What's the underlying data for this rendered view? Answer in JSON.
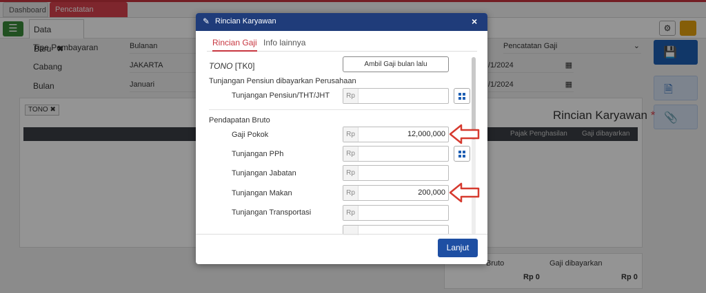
{
  "app_tabs": [
    {
      "label": "Dashboard"
    },
    {
      "label": "Pencatatan Gaji",
      "close": "✖"
    }
  ],
  "doc_tab": {
    "label": "Data Baru",
    "close": "✖"
  },
  "form": {
    "tipe_label": "Tipe Pembayaran",
    "tipe_value": "Bulanan",
    "cabang_label": "Cabang",
    "cabang_value": "JAKARTA",
    "bulan_label": "Bulan",
    "bulan_value": "Januari",
    "transaksi_value": "Pencatatan Gaji",
    "date1": "/1/2024",
    "date2": "/1/2024"
  },
  "card": {
    "tag": "TONO",
    "title": "Rincian Karyawan",
    "required_mark": "*",
    "col_pajak": "Pajak Penghasilan",
    "col_gaji": "Gaji dibayarkan"
  },
  "summary": {
    "bruto_label": "Bruto",
    "bruto_value": "Rp 0",
    "gaji_label": "Gaji dibayarkan",
    "gaji_value": "Rp 0"
  },
  "modal": {
    "title": "Rincian Karyawan",
    "close": "×",
    "tabs": [
      {
        "label": "Rincian Gaji",
        "active": true
      },
      {
        "label": "Info lainnya",
        "active": false
      }
    ],
    "employee_name": "TONO",
    "employee_code": "[TK0]",
    "prev_month_button": "Ambil Gaji bulan lalu",
    "section_pensiun": "Tunjangan Pensiun dibayarkan Perusahaan",
    "section_bruto": "Pendapatan Bruto",
    "currency": "Rp",
    "rows": [
      {
        "label": "Tunjangan Pensiun/THT/JHT",
        "value": ""
      },
      {
        "label": "Gaji Pokok",
        "value": "12,000,000"
      },
      {
        "label": "Tunjangan PPh",
        "value": ""
      },
      {
        "label": "Tunjangan Jabatan",
        "value": ""
      },
      {
        "label": "Tunjangan Makan",
        "value": "200,000"
      },
      {
        "label": "Tunjangan Transportasi",
        "value": ""
      }
    ],
    "next_button": "Lanjut"
  },
  "colors": {
    "header_blue": "#1f3c7a",
    "accent_red": "#c7353f",
    "primary_blue": "#1e4fa3",
    "arrow_red": "#d63a2f"
  },
  "icons": {
    "pencil": "pencil-icon",
    "close": "close-icon",
    "calculator": "grid-calculator-icon",
    "save": "save-icon",
    "document": "document-icon",
    "paperclip": "paperclip-icon",
    "gear": "gear-icon",
    "menu": "menu-icon"
  }
}
